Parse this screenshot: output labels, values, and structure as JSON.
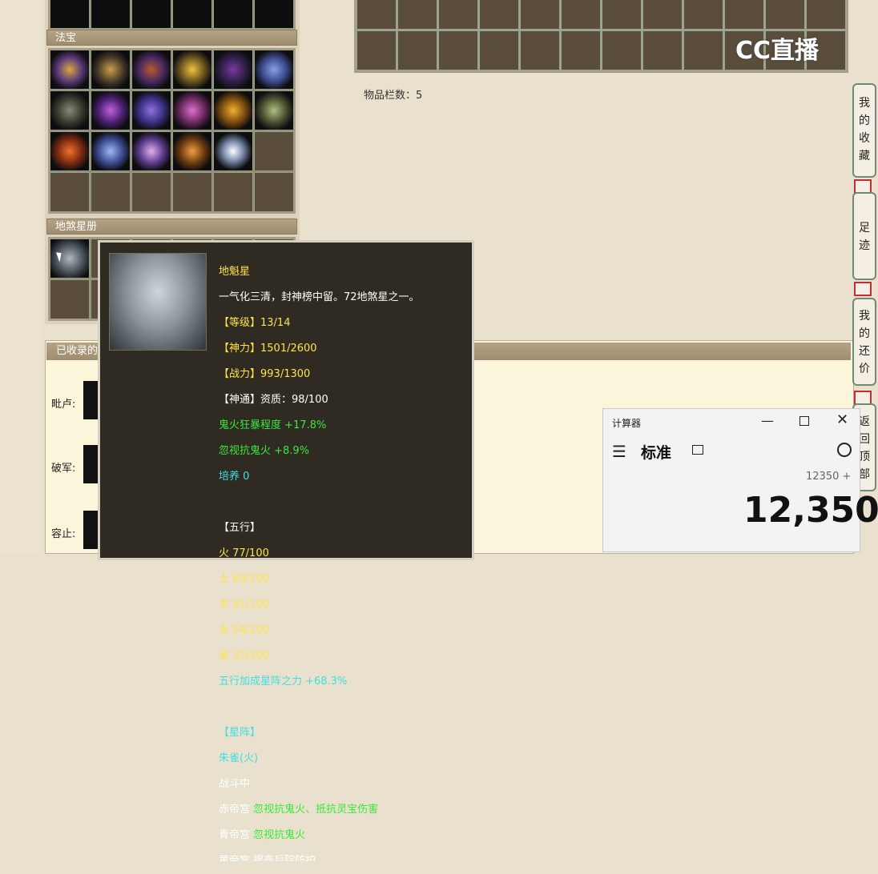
{
  "sections": {
    "fabao_title": "法宝",
    "disha_title": "地煞星册",
    "collected_title": "已收录的"
  },
  "inventory": {
    "count_label": "物品栏数：5"
  },
  "collected_rows": [
    {
      "label": "毗卢:"
    },
    {
      "label": "破军:"
    },
    {
      "label": "容止:"
    }
  ],
  "tooltip": {
    "name": "地魁星",
    "desc": "一气化三清，封神榜中留。72地煞星之一。",
    "level": "【等级】13/14",
    "shenli": "【神力】1501/2600",
    "zhanli": "【战力】993/1300",
    "shentong": "【神通】资质：98/100",
    "bonus1": "鬼火狂暴程度 +17.8%",
    "bonus2": "忽视抗鬼火 +8.9%",
    "peiyang": "培养 0",
    "wuxing_title": "【五行】",
    "fire": "火 77/100",
    "earth": "土 69/100",
    "wood": "木 91/100",
    "water": "水 54/100",
    "metal": "金 32/100",
    "wuxing_bonus": "五行加成星阵之力 +68.3%",
    "xingzhen_title": "【星阵】",
    "xingzhen_name": "朱雀(火)",
    "status": "战斗中",
    "palace1_name": "赤帝宫",
    "palace1_effect": "忽视抗鬼火、抵抗灵宝伤害",
    "palace2_name": "青帝宫",
    "palace2_effect": "忽视抗鬼火",
    "palace3_partial": "黄帝宫 提高后院防护"
  },
  "side_tabs": [
    {
      "label": "我的收藏"
    },
    {
      "label": "足迹"
    },
    {
      "label": "我的还价"
    },
    {
      "label": "返回顶部"
    }
  ],
  "calculator": {
    "window_title": "计算器",
    "mode": "标准",
    "expression": "12350 +",
    "display": "12,350"
  },
  "watermark": "CC直播"
}
